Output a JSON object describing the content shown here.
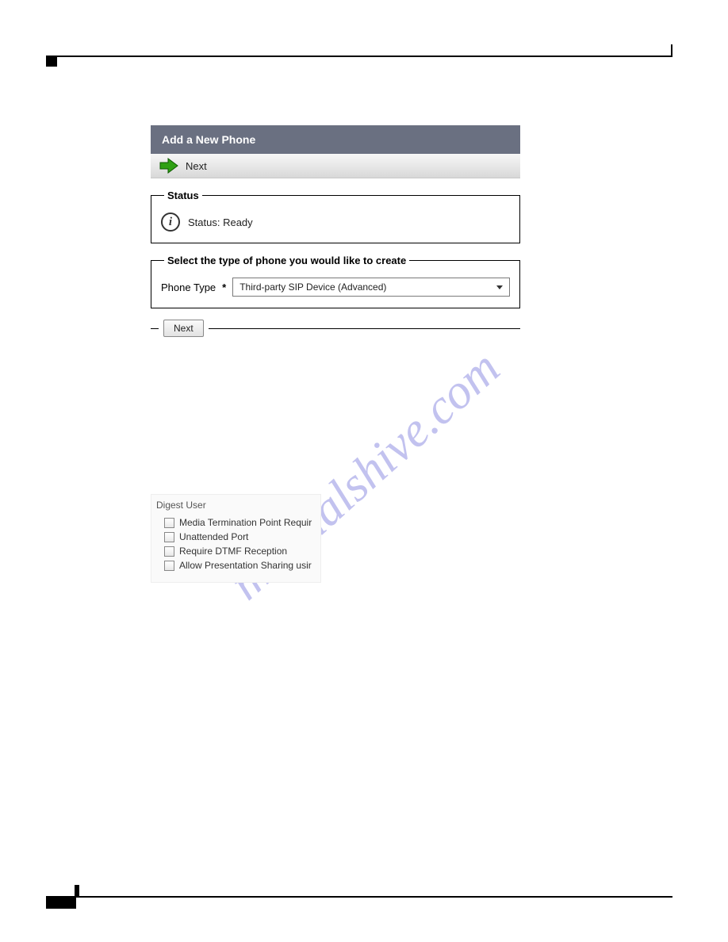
{
  "watermark": "manualshive.com",
  "panel": {
    "title": "Add a New Phone",
    "toolbar_next_label": "Next"
  },
  "status": {
    "legend": "Status",
    "text": "Status: Ready"
  },
  "phone_type": {
    "legend": "Select the type of phone you would like to create",
    "label": "Phone Type",
    "required_mark": "*",
    "selected": "Third-party SIP Device (Advanced)"
  },
  "next_button_label": "Next",
  "digest": {
    "title": "Digest User",
    "options": [
      "Media Termination Point Requir",
      "Unattended Port",
      "Require DTMF Reception",
      "Allow Presentation Sharing usir"
    ]
  }
}
